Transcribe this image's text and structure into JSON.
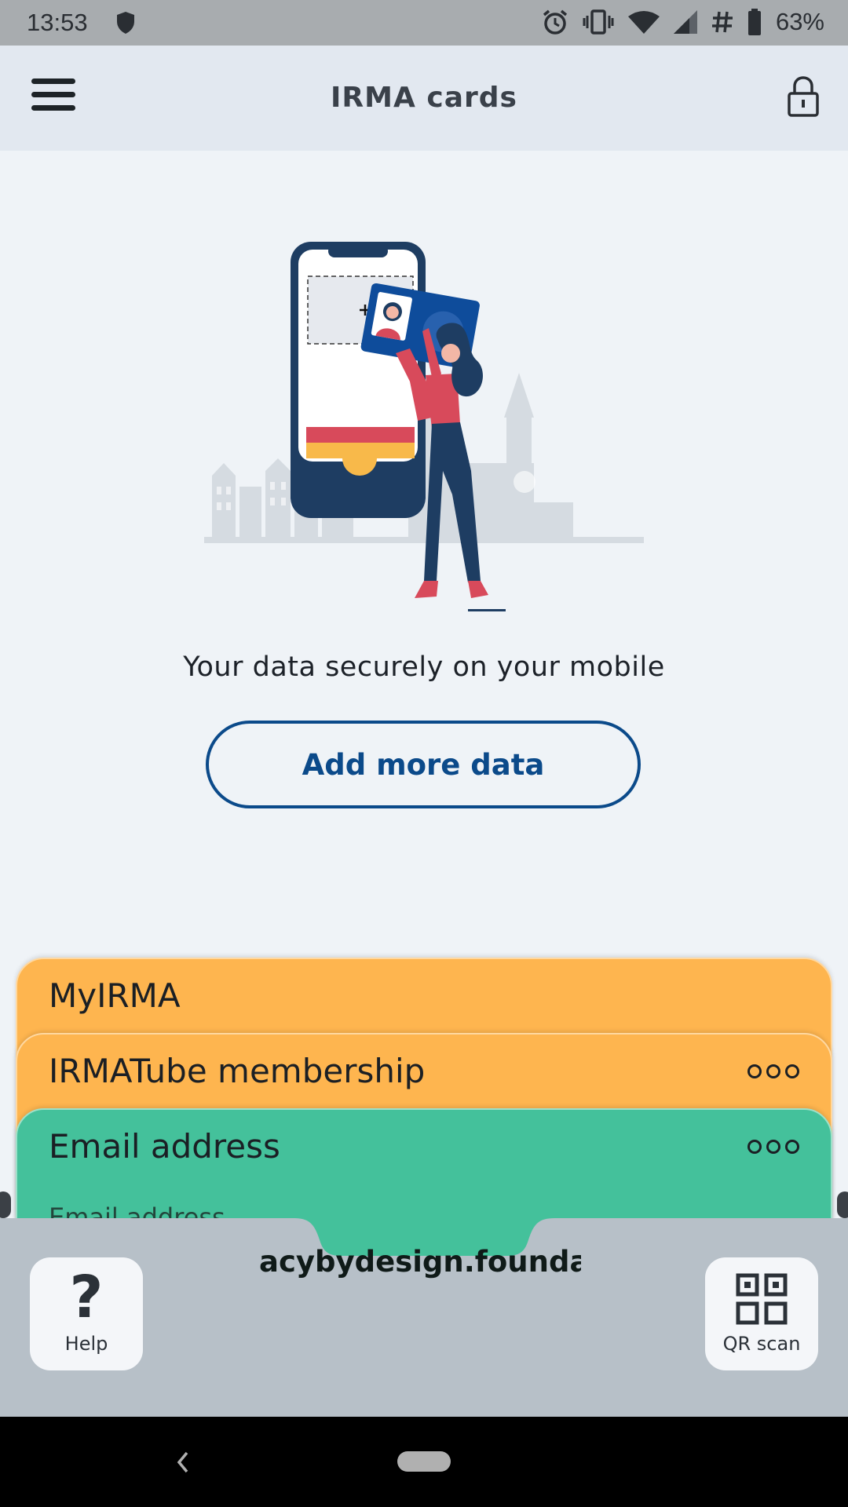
{
  "status_bar": {
    "time": "13:53",
    "battery": "63%",
    "icons": [
      "shield-icon",
      "alarm-icon",
      "vibrate-icon",
      "wifi-icon",
      "signal-icon",
      "hash-icon",
      "battery-icon"
    ]
  },
  "app_bar": {
    "title": "IRMA cards",
    "menu_icon": "hamburger-icon",
    "lock_icon": "lock-icon"
  },
  "hero": {
    "tagline": "Your data securely on your mobile",
    "add_button": "Add more data"
  },
  "cards": [
    {
      "title": "MyIRMA",
      "color": "#feb54f"
    },
    {
      "title": "IRMATube membership",
      "color": "#feb54f",
      "menu_icon": "more-icon"
    },
    {
      "title": "Email address",
      "color": "#44c19b",
      "menu_icon": "more-icon",
      "field_label": "Email address",
      "field_value": "acybydesign.foundat"
    }
  ],
  "bottom_bar": {
    "help_label": "Help",
    "qr_label": "QR scan"
  },
  "colors": {
    "accent": "#0b4a8a",
    "card_orange": "#feb54f",
    "card_green": "#44c19b",
    "app_bar": "#e2e8f0",
    "background": "#eff3f7"
  }
}
